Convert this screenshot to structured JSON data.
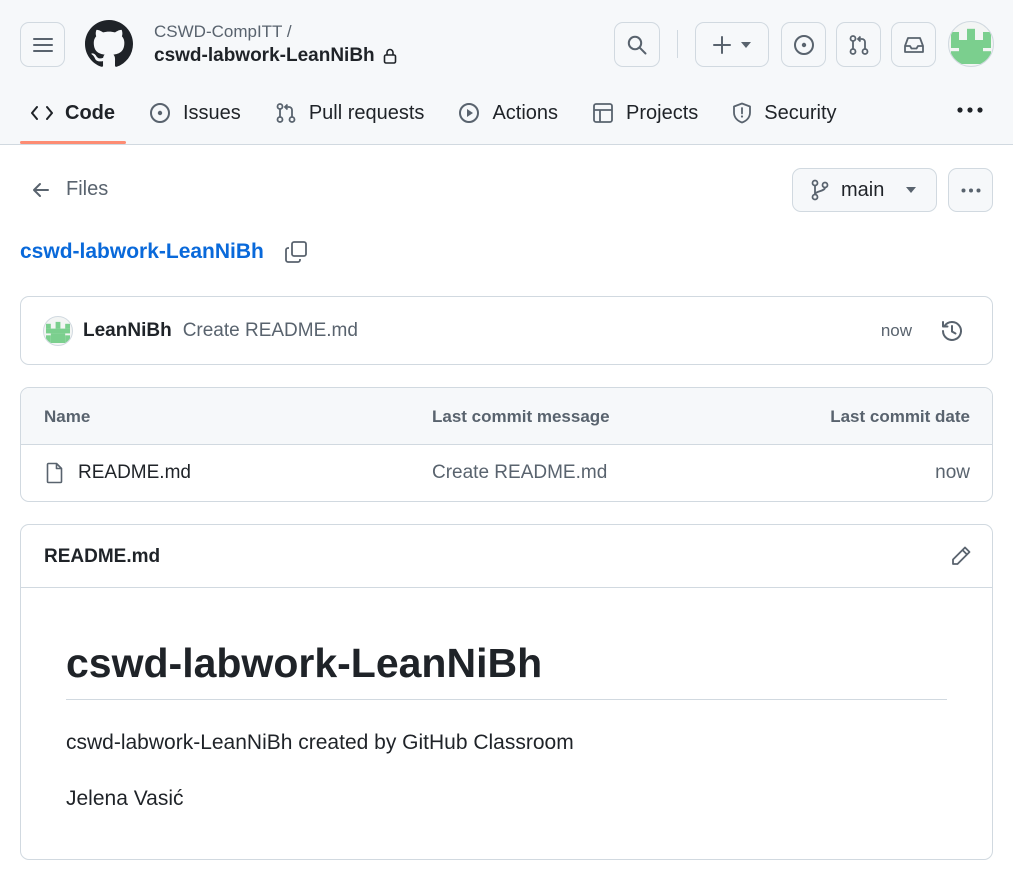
{
  "header": {
    "owner": "CSWD-CompITT /",
    "repo": "cswd-labwork-LeanNiBh",
    "icons": {
      "menu": "hamburger-icon",
      "logo": "github-logo-icon",
      "lock": "lock-icon",
      "search": "search-icon",
      "create": "plus-icon",
      "issues": "issue-opened-icon",
      "pulls": "git-pull-request-icon",
      "inbox": "inbox-icon"
    },
    "avatar_color": "#7bcf8e"
  },
  "tabs": [
    {
      "label": "Code",
      "icon": "code-icon",
      "selected": true
    },
    {
      "label": "Issues",
      "icon": "issue-opened-icon"
    },
    {
      "label": "Pull requests",
      "icon": "git-pull-request-icon"
    },
    {
      "label": "Actions",
      "icon": "play-icon"
    },
    {
      "label": "Projects",
      "icon": "table-icon"
    },
    {
      "label": "Security",
      "icon": "shield-icon"
    }
  ],
  "accent": {
    "tab_underline": "#fd8c73",
    "link": "#0969da"
  },
  "filebar": {
    "files_label": "Files",
    "branch": "main"
  },
  "repo_title": "cswd-labwork-LeanNiBh",
  "latest_commit": {
    "author": "LeanNiBh",
    "message": "Create README.md",
    "time": "now"
  },
  "table": {
    "headers": {
      "name": "Name",
      "message": "Last commit message",
      "date": "Last commit date"
    },
    "rows": [
      {
        "name": "README.md",
        "message": "Create README.md",
        "date": "now"
      }
    ]
  },
  "readme": {
    "file": "README.md",
    "heading": "cswd-labwork-LeanNiBh",
    "paragraph1": "cswd-labwork-LeanNiBh created by GitHub Classroom",
    "paragraph2": "Jelena Vasić"
  }
}
